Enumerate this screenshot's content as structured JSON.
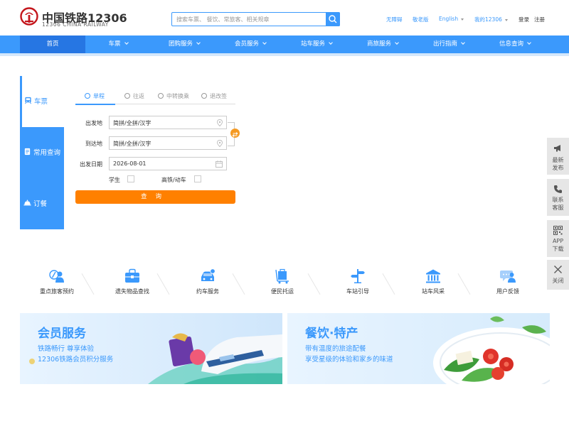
{
  "logo": {
    "cn": "中国铁路12306",
    "en": "12306 CHINA RAILWAY"
  },
  "search": {
    "placeholder": "搜索车票、 餐饮、常旅客、相关规章"
  },
  "toplinks": {
    "accessible": "无障碍",
    "elder": "敬老版",
    "english": "English",
    "my12306": "我的12306",
    "login": "登录",
    "register": "注册"
  },
  "nav": {
    "items": [
      {
        "label": "首页"
      },
      {
        "label": "车票"
      },
      {
        "label": "团购服务"
      },
      {
        "label": "会员服务"
      },
      {
        "label": "站车服务"
      },
      {
        "label": "商旅服务"
      },
      {
        "label": "出行指南"
      },
      {
        "label": "信息查询"
      }
    ]
  },
  "side_tabs": [
    {
      "label": "车票"
    },
    {
      "label": "常用查询"
    },
    {
      "label": "订餐"
    }
  ],
  "booking": {
    "subtabs": [
      {
        "label": "单程"
      },
      {
        "label": "往返"
      },
      {
        "label": "中转换乘"
      },
      {
        "label": "退改签"
      }
    ],
    "from_label": "出发地",
    "from_value": "简拼/全拼/汉字",
    "to_label": "到达地",
    "to_value": "简拼/全拼/汉字",
    "date_label": "出发日期",
    "date_value": "2026-08-01",
    "student_label": "学生",
    "highspeed_label": "高铁/动车",
    "query_label": "查询"
  },
  "services": [
    {
      "label": "重点旅客预约"
    },
    {
      "label": "遗失物品查找"
    },
    {
      "label": "约车服务"
    },
    {
      "label": "便民托运"
    },
    {
      "label": "车站引导"
    },
    {
      "label": "站车风采"
    },
    {
      "label": "用户反馈"
    }
  ],
  "banners": {
    "member": {
      "title": "会员服务",
      "line1": "铁路畅行 尊享体验",
      "line2": "12306铁路会员积分服务"
    },
    "food": {
      "title": "餐饮·特产",
      "line1": "带有温度的旅途配餐",
      "line2": "享受星级的体验和家乡的味道"
    }
  },
  "float_panel": {
    "announce": {
      "line1": "最新",
      "line2": "发布"
    },
    "contact": {
      "line1": "联系",
      "line2": "客服"
    },
    "app": {
      "line1": "APP",
      "line2": "下载"
    },
    "close": {
      "label": "关闭"
    }
  },
  "colors": {
    "brand_blue": "#3b99fc",
    "nav_active": "#2676e3",
    "query_orange": "#ff8000",
    "logo_red": "#c4161c"
  }
}
